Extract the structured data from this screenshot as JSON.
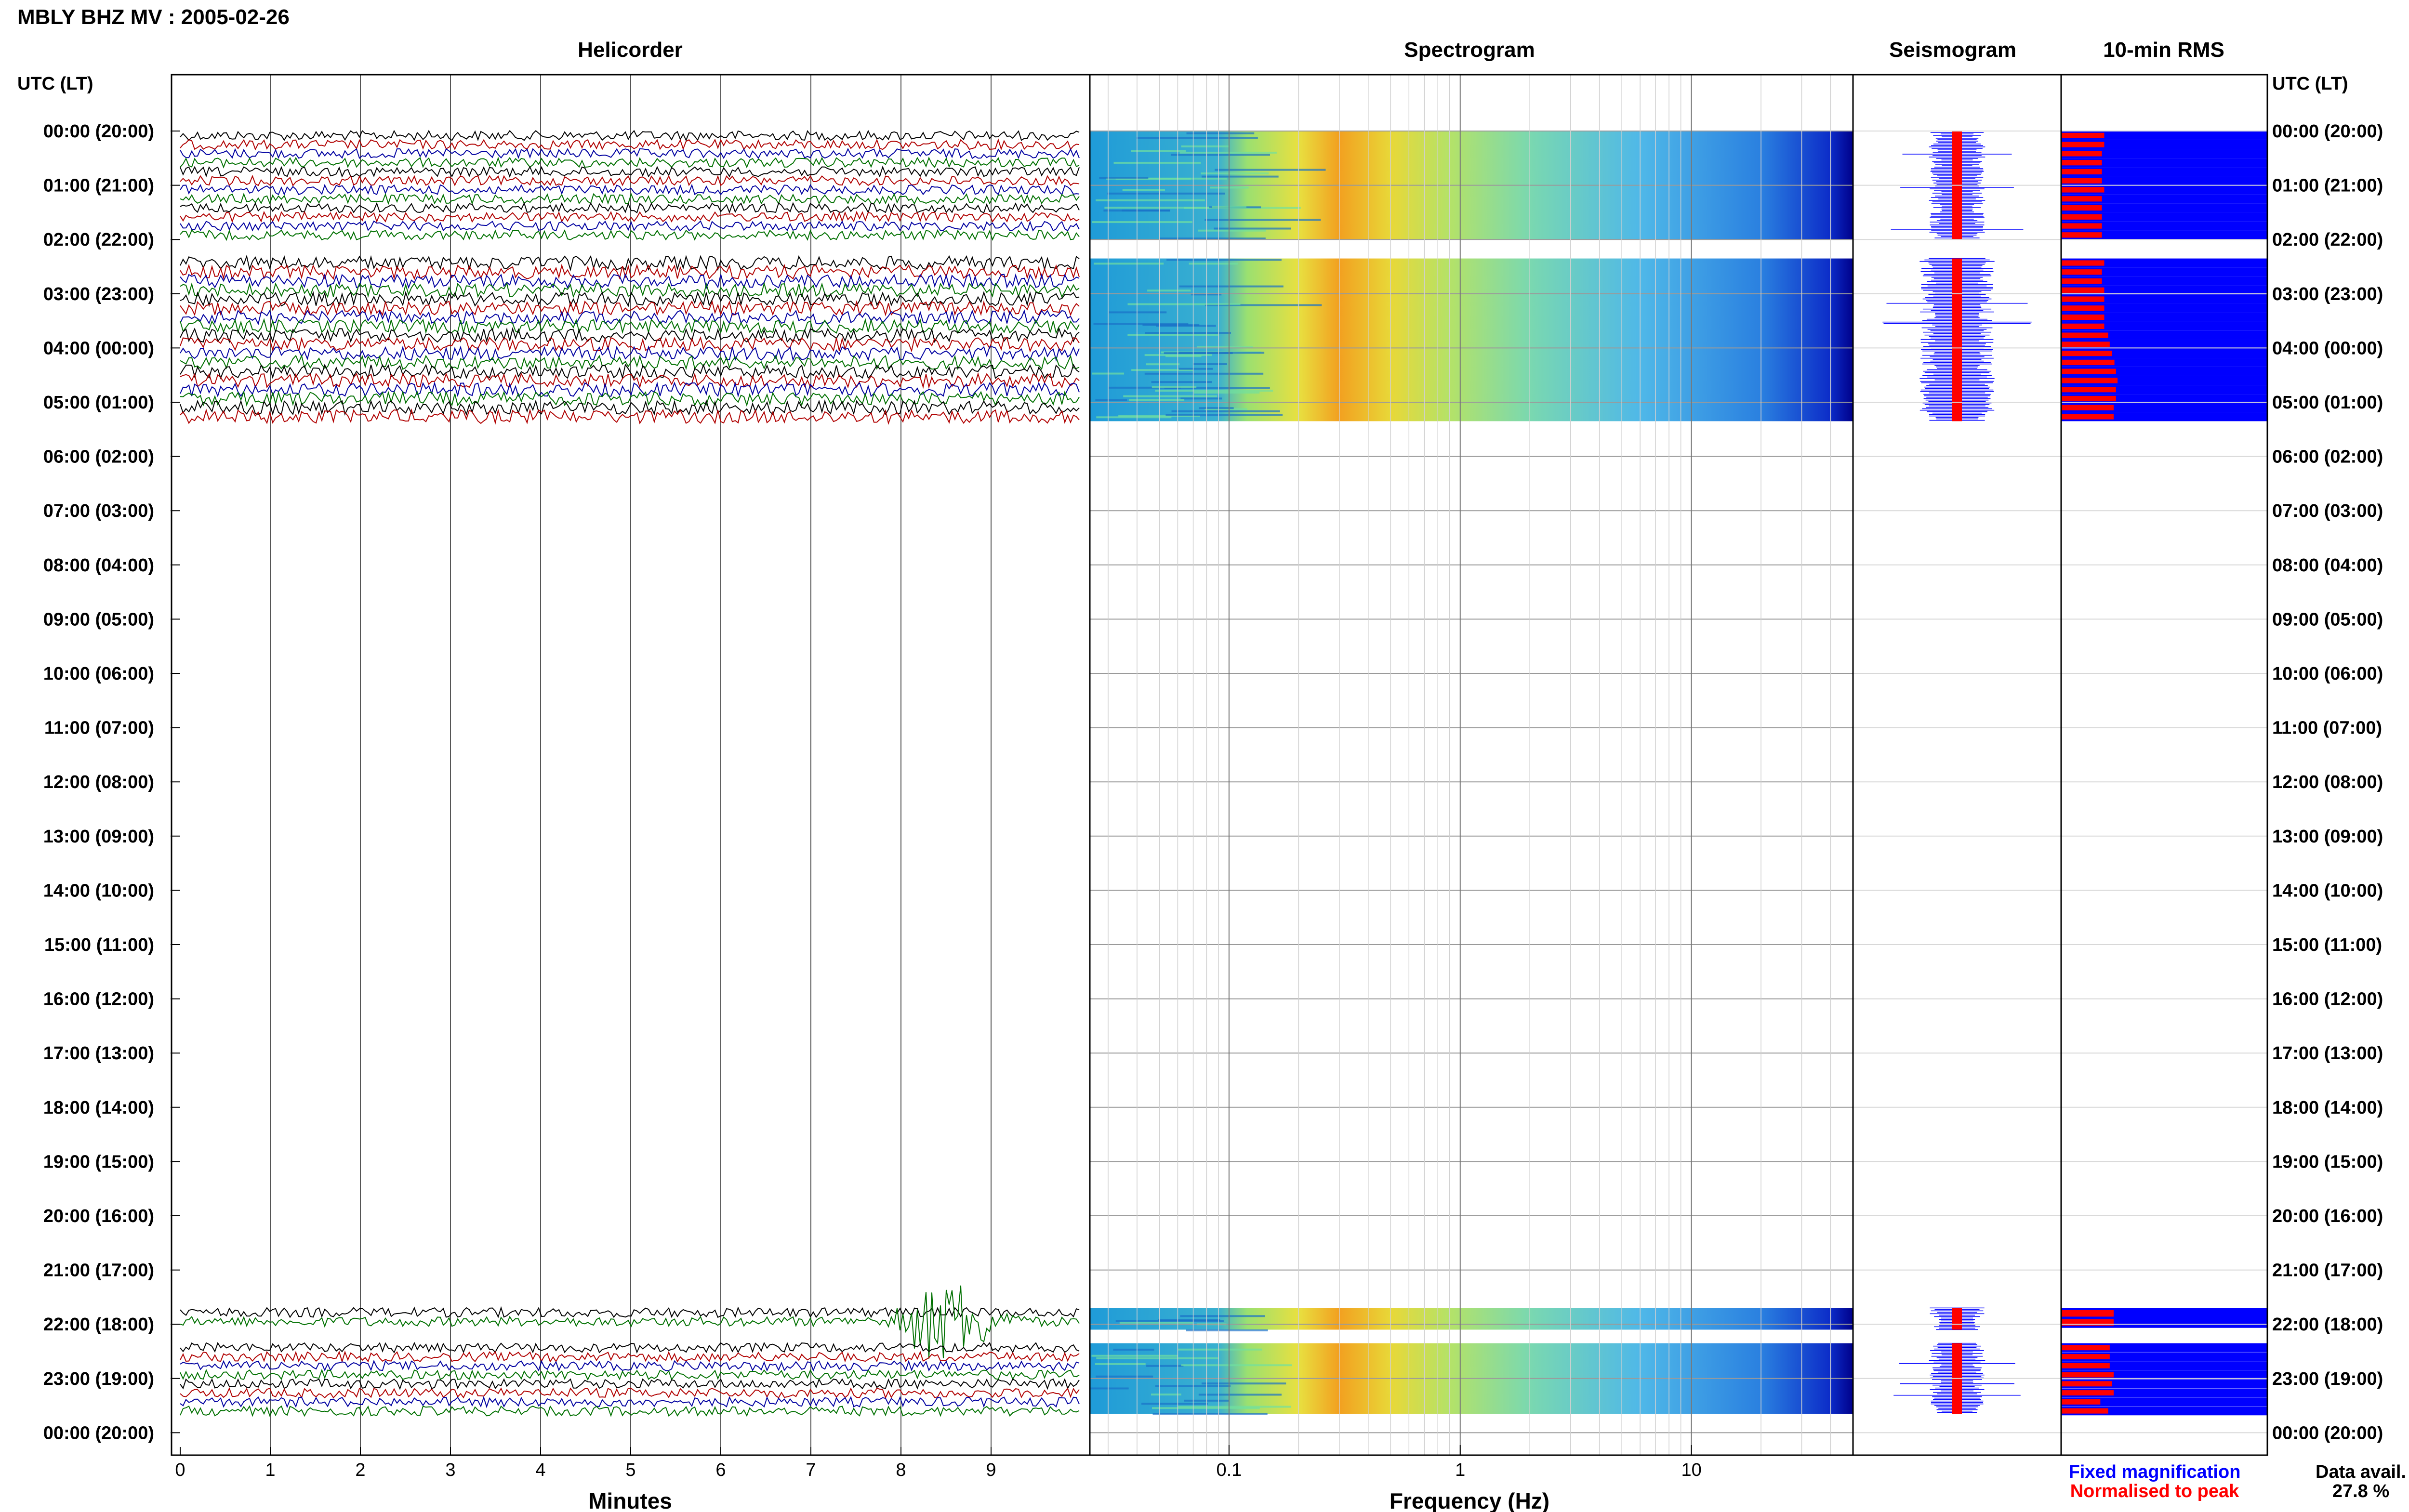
{
  "header": {
    "title": "MBLY BHZ MV : 2005-02-26"
  },
  "panels": {
    "helicorder": "Helicorder",
    "spectrogram": "Spectrogram",
    "seismogram": "Seismogram",
    "rms": "10-min RMS"
  },
  "axis": {
    "utc_lt_left": "UTC (LT)",
    "utc_lt_right": "UTC (LT)",
    "minutes_label": "Minutes",
    "frequency_label": "Frequency (Hz)"
  },
  "legend": {
    "fixed": "Fixed magnification",
    "normalised": "Normalised to peak",
    "fixed_color": "#0000ff",
    "normalised_color": "#ff0000"
  },
  "data_avail": {
    "label": "Data avail.",
    "value": "27.8 %"
  },
  "chart_data": {
    "type": "heatmap",
    "title": "MBLY BHZ MV : 2005-02-26",
    "row_labels": [
      "00:00 (20:00)",
      "01:00 (21:00)",
      "02:00 (22:00)",
      "03:00 (23:00)",
      "04:00 (00:00)",
      "05:00 (01:00)",
      "06:00 (02:00)",
      "07:00 (03:00)",
      "08:00 (04:00)",
      "09:00 (05:00)",
      "10:00 (06:00)",
      "11:00 (07:00)",
      "12:00 (08:00)",
      "13:00 (09:00)",
      "14:00 (10:00)",
      "15:00 (11:00)",
      "16:00 (12:00)",
      "17:00 (13:00)",
      "18:00 (14:00)",
      "19:00 (15:00)",
      "20:00 (16:00)",
      "21:00 (17:00)",
      "22:00 (18:00)",
      "23:00 (19:00)",
      "00:00 (20:00)"
    ],
    "minutes_ticks": [
      "0",
      "1",
      "2",
      "3",
      "4",
      "5",
      "6",
      "7",
      "8",
      "9"
    ],
    "minutes_range": [
      0,
      10
    ],
    "frequency_ticks": [
      "0.1",
      "1",
      "10"
    ],
    "frequency_range": [
      0.025,
      50
    ],
    "frequency_scale": "log",
    "trace_colors": [
      "#000000",
      "#b00000",
      "#0000a0",
      "#007000"
    ],
    "data_blocks_hours": [
      [
        0,
        2
      ],
      [
        2.35,
        5.35
      ],
      [
        21.7,
        22.1
      ],
      [
        22.35,
        23.65
      ]
    ],
    "event_at": {
      "hour": 21.7,
      "minute": 8.5
    },
    "rms_normalised": [
      0.55,
      0.55,
      0.52,
      0.52,
      0.52,
      0.52,
      0.55,
      0.52,
      0.52,
      0.52,
      0.52,
      0.52,
      0.55,
      0.52,
      0.52,
      0.55,
      0.55,
      0.55,
      0.55,
      0.55,
      0.6,
      0.62,
      0.65,
      0.68,
      0.7,
      0.72,
      0.7,
      0.7,
      0.67,
      0.67,
      0.67,
      0.67,
      0.62,
      0.62,
      0.62,
      0.67,
      0.65,
      0.67,
      0.5,
      0.6,
      0.48,
      0.5,
      0.48,
      0.48,
      0.48,
      0.48,
      0.48,
      0.48,
      0.48,
      0.48,
      0.48,
      0.48,
      0.48
    ],
    "rms_fixed": [
      1,
      1,
      1,
      1,
      1,
      1,
      1,
      1,
      1,
      1,
      1,
      1,
      1,
      1,
      1,
      1,
      1,
      1,
      1,
      1,
      1,
      1,
      1,
      1,
      1,
      1,
      1,
      1,
      1,
      1,
      1,
      1,
      1,
      1,
      1,
      1,
      1,
      1,
      1,
      1,
      0.95,
      0.97,
      1,
      1,
      0.98,
      0.95,
      1,
      0.97,
      0.95,
      0.92,
      0.96,
      0.98,
      0.9
    ]
  }
}
